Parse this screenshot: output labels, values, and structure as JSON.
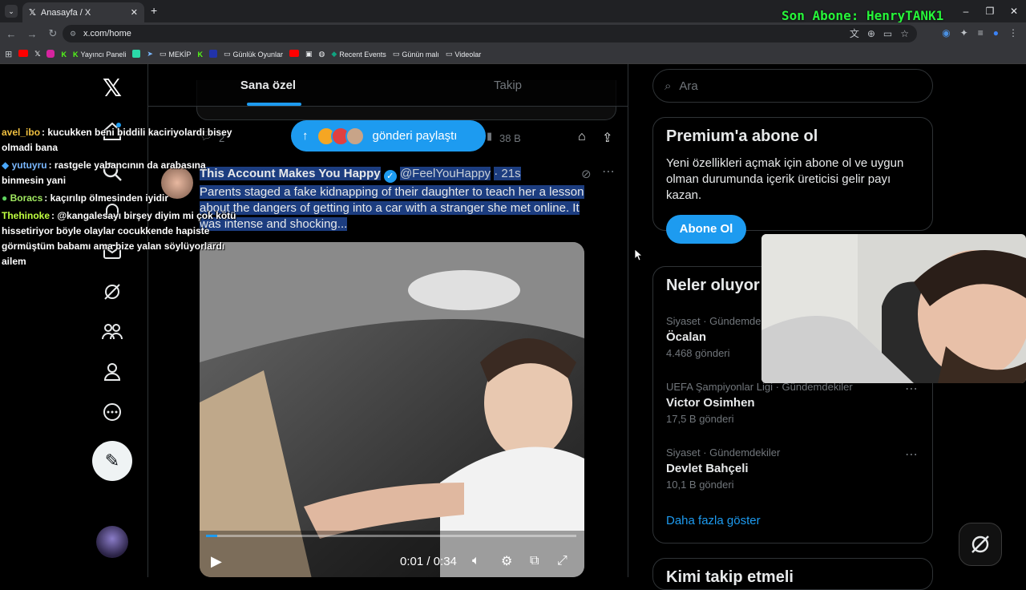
{
  "browser": {
    "tab_title": "Anasayfa / X",
    "url": "x.com/home",
    "bookmarks": [
      "Yayıncı Paneli",
      "MEKİP",
      "Günlük Oyunlar",
      "Recent Events",
      "Günün malı",
      "Videolar"
    ]
  },
  "stream_overlay": {
    "last_sub": "Son Abone: HenryTANK1",
    "chat": [
      {
        "user": "avel_ibo",
        "color": "#f0c040",
        "text": ": kucukken beni biddili kaciriyolardi bisey olmadi bana"
      },
      {
        "user": "yutuyru",
        "color": "#7ab8ff",
        "text": ": rastgele yabancının da arabasına binmesin yani"
      },
      {
        "user": "Boracs",
        "color": "#a0e860",
        "text": ": kaçırılıp ölmesinden iyidir"
      },
      {
        "user": "Thehinoke",
        "color": "#c0ff40",
        "text": ": @kangalesayı birşey diyim mi çok kötü hissetiriyor böyle olaylar cocukkende hapiste görmüştüm babamı ama bize yalan söylüyorlardı ailem"
      }
    ]
  },
  "timeline": {
    "tabs": [
      "Sana özel",
      "Takip"
    ],
    "prev_replies": "2",
    "prev_views": "38 B",
    "share_pill": "gönderi paylaştı",
    "tweet": {
      "name": "This Account Makes You Happy",
      "handle": "@FeelYouHappy",
      "time": "· 21s",
      "text": "Parents staged a fake kidnapping of their daughter to teach her a lesson about the dangers of getting into a car with a stranger she met online. It was intense and shocking..."
    },
    "video": {
      "time": "0:01 / 0:34",
      "progress": 0.03
    }
  },
  "right": {
    "search_placeholder": "Ara",
    "premium": {
      "title": "Premium'a abone ol",
      "desc": "Yeni özellikleri açmak için abone ol ve uygun olman durumunda içerik üreticisi gelir payı kazan.",
      "button": "Abone Ol"
    },
    "trends": {
      "title": "Neler oluyor",
      "items": [
        {
          "ctx": "Siyaset · Gündemde",
          "name": "Öcalan",
          "count": "4.468 gönderi"
        },
        {
          "ctx": "UEFA Şampiyonlar Ligi · Gündemdekiler",
          "name": "Victor Osimhen",
          "count": "17,5 B gönderi"
        },
        {
          "ctx": "Siyaset · Gündemdekiler",
          "name": "Devlet Bahçeli",
          "count": "10,1 B gönderi"
        }
      ],
      "show_more": "Daha fazla göster"
    },
    "who_to_follow": "Kimi takip etmeli"
  },
  "colors": {
    "accent": "#1d9bf0",
    "selection": "#1c3d80",
    "overlay_green": "#27f53a"
  }
}
